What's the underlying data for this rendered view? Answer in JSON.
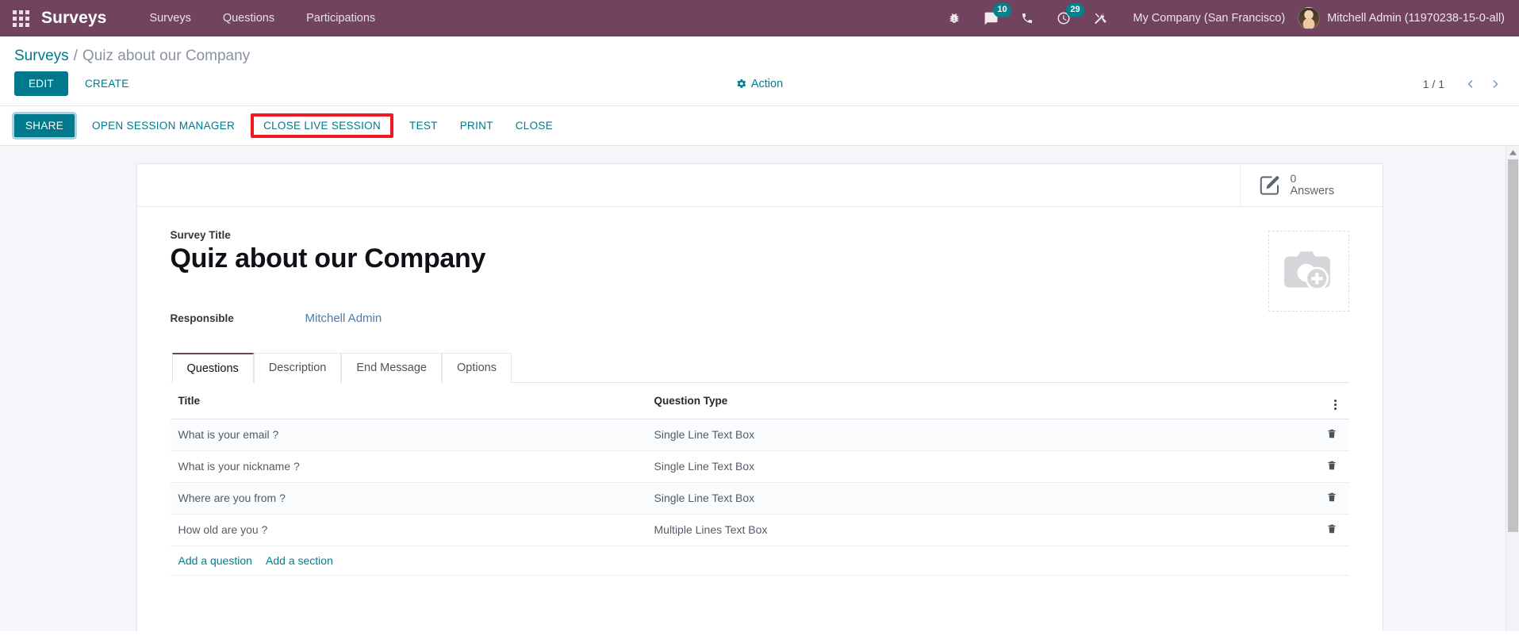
{
  "navbar": {
    "apps_icon": "grid-apps-icon",
    "brand": "Surveys",
    "menu": [
      {
        "label": "Surveys"
      },
      {
        "label": "Questions"
      },
      {
        "label": "Participations"
      }
    ],
    "sys_icons": [
      {
        "name": "bug-icon",
        "badge": null
      },
      {
        "name": "messages-icon",
        "badge": "10"
      },
      {
        "name": "phone-icon",
        "badge": null
      },
      {
        "name": "activities-clock-icon",
        "badge": "29"
      },
      {
        "name": "tools-wrench-icon",
        "badge": null
      }
    ],
    "company": "My Company (San Francisco)",
    "user": "Mitchell Admin (11970238-15-0-all)"
  },
  "breadcrumb": {
    "root": "Surveys",
    "separator": "/",
    "current": "Quiz about our Company"
  },
  "control_panel": {
    "edit_label": "EDIT",
    "create_label": "CREATE",
    "action_label": "Action",
    "action_icon": "gear-icon",
    "pager_count": "1 / 1",
    "prev_icon": "chevron-left-icon",
    "next_icon": "chevron-right-icon"
  },
  "statusbar": {
    "buttons": [
      {
        "label": "SHARE",
        "style": "primary"
      },
      {
        "label": "OPEN SESSION MANAGER",
        "style": "plain"
      },
      {
        "label": "CLOSE LIVE SESSION",
        "style": "highlighted"
      },
      {
        "label": "TEST",
        "style": "plain"
      },
      {
        "label": "PRINT",
        "style": "plain"
      },
      {
        "label": "CLOSE",
        "style": "plain"
      }
    ],
    "highlight_color": "#ef1b24"
  },
  "form": {
    "stat_button": {
      "icon": "edit-square-pencil-icon",
      "value": "0",
      "label": "Answers"
    },
    "title_label": "Survey Title",
    "title_value": "Quiz about our Company",
    "image_placeholder_icon": "camera-add-icon",
    "responsible_label": "Responsible",
    "responsible_value": "Mitchell Admin"
  },
  "notebook": {
    "tabs": [
      {
        "label": "Questions",
        "active": true
      },
      {
        "label": "Description",
        "active": false
      },
      {
        "label": "End Message",
        "active": false
      },
      {
        "label": "Options",
        "active": false
      }
    ]
  },
  "questions_table": {
    "columns": [
      "Title",
      "Question Type"
    ],
    "optional_columns_icon": "vertical-dots-icon",
    "row_delete_icon": "trash-icon",
    "rows": [
      {
        "title": "What is your email ?",
        "type": "Single Line Text Box"
      },
      {
        "title": "What is your nickname ?",
        "type": "Single Line Text Box"
      },
      {
        "title": "Where are you from ?",
        "type": "Single Line Text Box"
      },
      {
        "title": "How old are you ?",
        "type": "Multiple Lines Text Box"
      }
    ],
    "add_question_label": "Add a question",
    "add_section_label": "Add a section"
  },
  "theme": {
    "navbar_bg": "#71435f",
    "accent": "#00798c",
    "link": "#017e8f"
  }
}
